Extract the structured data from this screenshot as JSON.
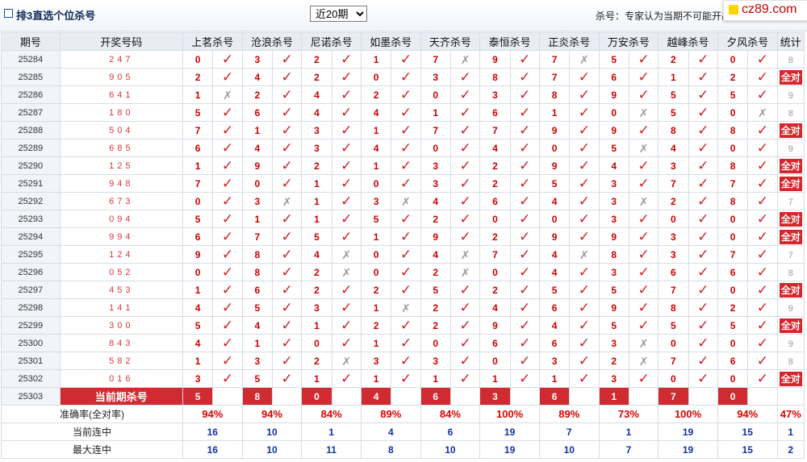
{
  "header": {
    "title": "排3直选个位杀号",
    "period_select": {
      "selected": "近20期",
      "options": [
        "近20期"
      ]
    },
    "notice": "杀号：专家认为当期不可能开出的号码，二次加",
    "logo_text": "cz89.com"
  },
  "colors": {
    "accent_red": "#d02b30",
    "check_red": "#d11f25",
    "header_bg": "#e9edf3",
    "blue": "#1131a8"
  },
  "table": {
    "headers": [
      "期号",
      "开奖号码",
      "上茗杀号",
      "沧浪杀号",
      "尼诺杀号",
      "如墨杀号",
      "天齐杀号",
      "泰恒杀号",
      "正炎杀号",
      "万安杀号",
      "越峰杀号",
      "夕风杀号",
      "统计"
    ],
    "rows": [
      {
        "issue": "25284",
        "nums": "247",
        "kills": [
          "0",
          "3",
          "2",
          "1",
          "7",
          "9",
          "7",
          "5",
          "2",
          "0"
        ],
        "marks": [
          "✓",
          "✓",
          "✓",
          "✓",
          "✗",
          "✓",
          "✗",
          "✓",
          "✓",
          "✓"
        ],
        "stat": "8"
      },
      {
        "issue": "25285",
        "nums": "905",
        "kills": [
          "2",
          "4",
          "2",
          "0",
          "3",
          "8",
          "7",
          "6",
          "1",
          "2"
        ],
        "marks": [
          "✓",
          "✓",
          "✓",
          "✓",
          "✓",
          "✓",
          "✓",
          "✓",
          "✓",
          "✓"
        ],
        "stat": "全对"
      },
      {
        "issue": "25286",
        "nums": "641",
        "kills": [
          "1",
          "2",
          "4",
          "2",
          "0",
          "3",
          "8",
          "9",
          "5",
          "5"
        ],
        "marks": [
          "✗",
          "✓",
          "✓",
          "✓",
          "✓",
          "✓",
          "✓",
          "✓",
          "✓",
          "✓"
        ],
        "stat": "9"
      },
      {
        "issue": "25287",
        "nums": "180",
        "kills": [
          "5",
          "6",
          "4",
          "4",
          "1",
          "6",
          "1",
          "0",
          "5",
          "0"
        ],
        "marks": [
          "✓",
          "✓",
          "✓",
          "✓",
          "✓",
          "✓",
          "✓",
          "✗",
          "✓",
          "✗"
        ],
        "stat": "8"
      },
      {
        "issue": "25288",
        "nums": "504",
        "kills": [
          "7",
          "1",
          "3",
          "1",
          "7",
          "7",
          "9",
          "9",
          "8",
          "8"
        ],
        "marks": [
          "✓",
          "✓",
          "✓",
          "✓",
          "✓",
          "✓",
          "✓",
          "✓",
          "✓",
          "✓"
        ],
        "stat": "全对"
      },
      {
        "issue": "25289",
        "nums": "685",
        "kills": [
          "6",
          "4",
          "3",
          "4",
          "0",
          "4",
          "0",
          "5",
          "4",
          "0"
        ],
        "marks": [
          "✓",
          "✓",
          "✓",
          "✓",
          "✓",
          "✓",
          "✓",
          "✗",
          "✓",
          "✓"
        ],
        "stat": "9"
      },
      {
        "issue": "25290",
        "nums": "125",
        "kills": [
          "1",
          "9",
          "2",
          "1",
          "3",
          "2",
          "9",
          "4",
          "3",
          "8"
        ],
        "marks": [
          "✓",
          "✓",
          "✓",
          "✓",
          "✓",
          "✓",
          "✓",
          "✓",
          "✓",
          "✓"
        ],
        "stat": "全对"
      },
      {
        "issue": "25291",
        "nums": "948",
        "kills": [
          "7",
          "0",
          "1",
          "0",
          "3",
          "2",
          "5",
          "3",
          "7",
          "7"
        ],
        "marks": [
          "✓",
          "✓",
          "✓",
          "✓",
          "✓",
          "✓",
          "✓",
          "✓",
          "✓",
          "✓"
        ],
        "stat": "全对"
      },
      {
        "issue": "25292",
        "nums": "673",
        "kills": [
          "0",
          "3",
          "1",
          "3",
          "4",
          "6",
          "4",
          "3",
          "2",
          "8"
        ],
        "marks": [
          "✓",
          "✗",
          "✓",
          "✗",
          "✓",
          "✓",
          "✓",
          "✗",
          "✓",
          "✓"
        ],
        "stat": "7"
      },
      {
        "issue": "25293",
        "nums": "094",
        "kills": [
          "5",
          "1",
          "1",
          "5",
          "2",
          "0",
          "0",
          "3",
          "0",
          "0"
        ],
        "marks": [
          "✓",
          "✓",
          "✓",
          "✓",
          "✓",
          "✓",
          "✓",
          "✓",
          "✓",
          "✓"
        ],
        "stat": "全对"
      },
      {
        "issue": "25294",
        "nums": "994",
        "kills": [
          "6",
          "7",
          "5",
          "1",
          "9",
          "2",
          "9",
          "9",
          "3",
          "0"
        ],
        "marks": [
          "✓",
          "✓",
          "✓",
          "✓",
          "✓",
          "✓",
          "✓",
          "✓",
          "✓",
          "✓"
        ],
        "stat": "全对"
      },
      {
        "issue": "25295",
        "nums": "124",
        "kills": [
          "9",
          "8",
          "4",
          "0",
          "4",
          "7",
          "4",
          "8",
          "3",
          "7"
        ],
        "marks": [
          "✓",
          "✓",
          "✗",
          "✓",
          "✗",
          "✓",
          "✗",
          "✓",
          "✓",
          "✓"
        ],
        "stat": "7"
      },
      {
        "issue": "25296",
        "nums": "052",
        "kills": [
          "0",
          "8",
          "2",
          "0",
          "2",
          "0",
          "4",
          "3",
          "6",
          "6"
        ],
        "marks": [
          "✓",
          "✓",
          "✗",
          "✓",
          "✗",
          "✓",
          "✓",
          "✓",
          "✓",
          "✓"
        ],
        "stat": "8"
      },
      {
        "issue": "25297",
        "nums": "453",
        "kills": [
          "1",
          "6",
          "2",
          "2",
          "5",
          "2",
          "5",
          "5",
          "7",
          "0"
        ],
        "marks": [
          "✓",
          "✓",
          "✓",
          "✓",
          "✓",
          "✓",
          "✓",
          "✓",
          "✓",
          "✓"
        ],
        "stat": "全对"
      },
      {
        "issue": "25298",
        "nums": "141",
        "kills": [
          "4",
          "5",
          "3",
          "1",
          "2",
          "4",
          "6",
          "9",
          "8",
          "2"
        ],
        "marks": [
          "✓",
          "✓",
          "✓",
          "✗",
          "✓",
          "✓",
          "✓",
          "✓",
          "✓",
          "✓"
        ],
        "stat": "9"
      },
      {
        "issue": "25299",
        "nums": "300",
        "kills": [
          "5",
          "4",
          "1",
          "2",
          "2",
          "9",
          "4",
          "5",
          "5",
          "5"
        ],
        "marks": [
          "✓",
          "✓",
          "✓",
          "✓",
          "✓",
          "✓",
          "✓",
          "✓",
          "✓",
          "✓"
        ],
        "stat": "全对"
      },
      {
        "issue": "25300",
        "nums": "843",
        "kills": [
          "4",
          "1",
          "0",
          "1",
          "0",
          "6",
          "6",
          "3",
          "0",
          "0"
        ],
        "marks": [
          "✓",
          "✓",
          "✓",
          "✓",
          "✓",
          "✓",
          "✓",
          "✗",
          "✓",
          "✓"
        ],
        "stat": "9"
      },
      {
        "issue": "25301",
        "nums": "582",
        "kills": [
          "1",
          "3",
          "2",
          "3",
          "3",
          "0",
          "3",
          "2",
          "7",
          "6"
        ],
        "marks": [
          "✓",
          "✓",
          "✗",
          "✓",
          "✓",
          "✓",
          "✓",
          "✗",
          "✓",
          "✓"
        ],
        "stat": "8"
      },
      {
        "issue": "25302",
        "nums": "016",
        "kills": [
          "3",
          "5",
          "1",
          "1",
          "1",
          "1",
          "1",
          "3",
          "0",
          "0"
        ],
        "marks": [
          "✓",
          "✓",
          "✓",
          "✓",
          "✓",
          "✓",
          "✓",
          "✓",
          "✓",
          "✓"
        ],
        "stat": "全对"
      }
    ],
    "current": {
      "issue": "25303",
      "label": "当前期杀号",
      "kills": [
        "5",
        "8",
        "0",
        "4",
        "6",
        "3",
        "6",
        "1",
        "7",
        "0"
      ]
    },
    "summary": [
      {
        "label": "准确率(全对率)",
        "values": [
          "94%",
          "94%",
          "84%",
          "89%",
          "84%",
          "100%",
          "89%",
          "73%",
          "100%",
          "94%"
        ],
        "stat": "47%"
      },
      {
        "label": "当前连中",
        "values": [
          "16",
          "10",
          "1",
          "4",
          "6",
          "19",
          "7",
          "1",
          "19",
          "15"
        ],
        "stat": "1"
      },
      {
        "label": "最大连中",
        "values": [
          "16",
          "10",
          "11",
          "8",
          "10",
          "19",
          "10",
          "7",
          "19",
          "15"
        ],
        "stat": "2"
      }
    ]
  }
}
